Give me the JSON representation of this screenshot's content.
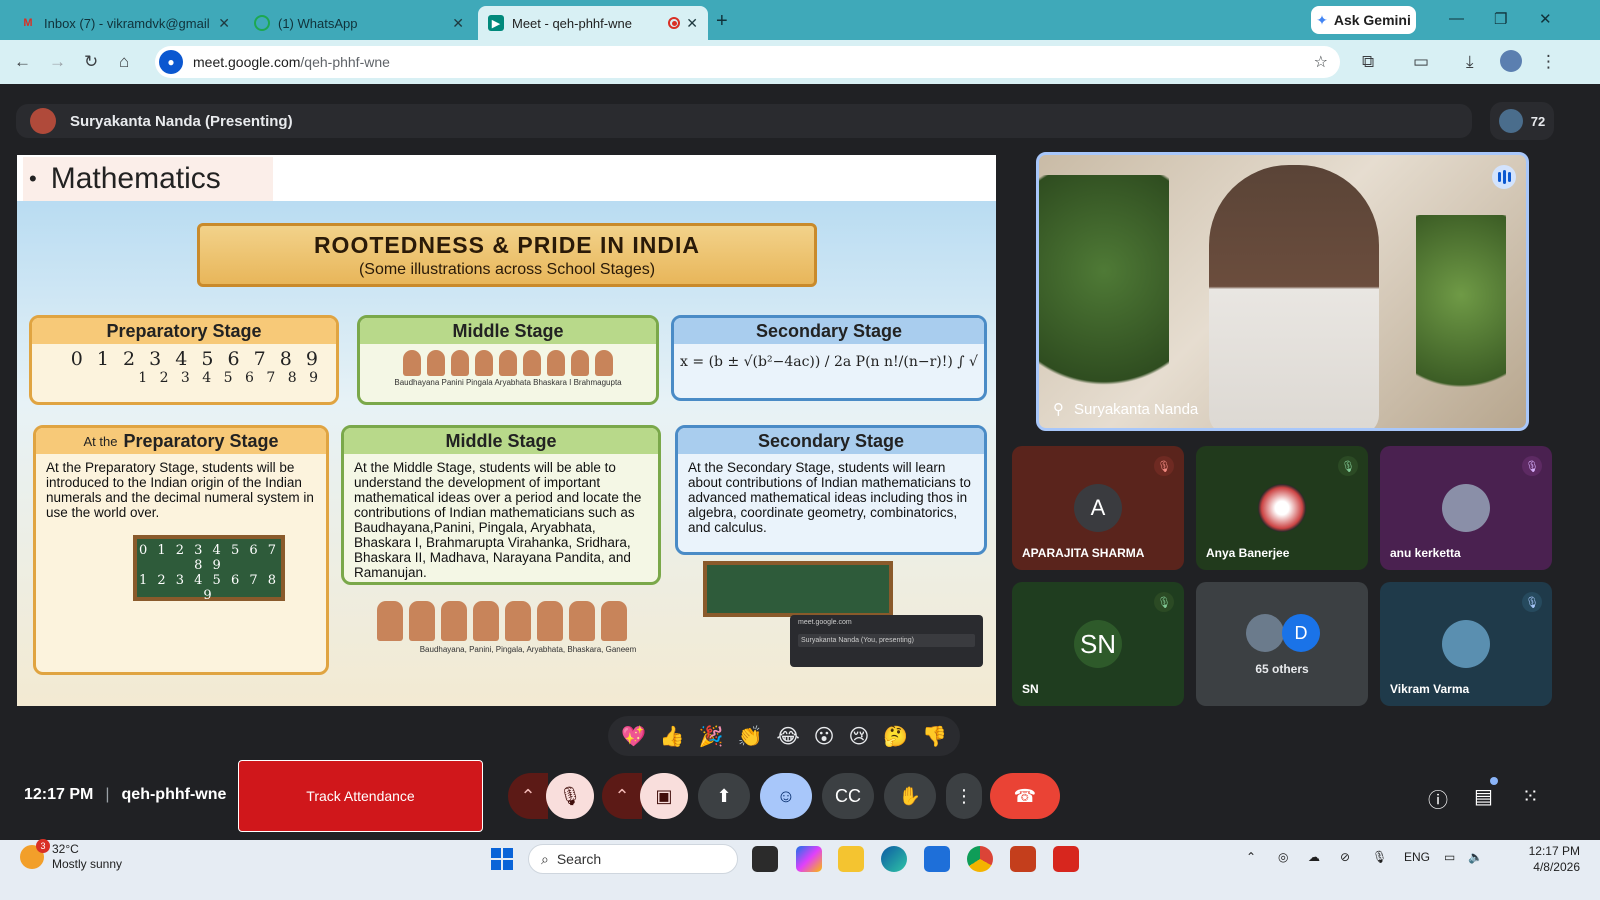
{
  "browser": {
    "tabs": [
      {
        "title": "Inbox (7) - vikramdvk@gmail.co",
        "icon": "gmail-icon"
      },
      {
        "title": "(1) WhatsApp",
        "icon": "whatsapp-icon"
      },
      {
        "title": "Meet - qeh-phhf-wne",
        "icon": "meet-icon",
        "active": true
      }
    ],
    "new_tab_glyph": "+",
    "ask_gemini": "Ask Gemini",
    "url_host": "meet.google.com",
    "url_path": "/qeh-phhf-wne"
  },
  "meet": {
    "presenting_label": "Suryakanta Nanda (Presenting)",
    "participant_count": "72",
    "slide": {
      "bullet": "Mathematics",
      "banner_title": "ROOTEDNESS & PRIDE IN INDIA",
      "banner_subtitle": "(Some illustrations across School Stages)",
      "top_stages": [
        {
          "title": "Preparatory Stage",
          "numerals_1": "0 1 2 3 4 5 6 7 8 9",
          "numerals_2": "1 2 3 4 5 6 7 8 9"
        },
        {
          "title": "Middle Stage",
          "caption": "Baudhayana  Panini  Pingala  Aryabhata  Bhaskara I  Brahmagupta"
        },
        {
          "title": "Secondary Stage",
          "formula": "x = (b ± √(b²−4ac)) / 2a   P(n n!/(n−r)!)  ∫ √"
        }
      ],
      "prep_prefix": "At the",
      "bottom_stages": [
        {
          "title": "Preparatory Stage",
          "text": "At the Preparatory Stage, students will be introduced to the Indian origin of the Indian numerals and the decimal numeral system in use the world over."
        },
        {
          "title": "Middle Stage",
          "text": "At the Middle Stage, students will be able to understand the development of important mathematical ideas over a period and locate the contributions of Indian mathematicians such as Baudhayana,Panini, Pingala, Aryabhata, Bhaskara I, Brahmarupta Virahanka, Sridhara, Bhaskara II, Madhava, Narayana Pandita, and Ramanujan."
        },
        {
          "title": "Secondary Stage",
          "text": "At the Secondary Stage, students will learn about contributions of Indian mathematicians to advanced mathematical ideas including thos in algebra, coordinate geometry, combinatorics, and calculus."
        }
      ],
      "board_row_1": "0 1 2 3 4 5 6 7 8 9",
      "board_row_2": "1 2 3 4 5 6 7 8 9",
      "bottom_caption": "Baudhayana, Panini, Pingala, Aryabhata, Bhaskara, Ganeem",
      "mini_pip_url": "meet.google.com",
      "mini_pip_name": "Suryakanta Nanda (You, presenting)"
    },
    "speaker_name": "Suryakanta Nanda",
    "tiles": [
      {
        "initial": "A",
        "name": "APARAJITA SHARMA",
        "bg": "#5a241c",
        "circle": "#3a3b3f"
      },
      {
        "initial": "",
        "name": "Anya Banerjee",
        "bg": "#213a1c",
        "circle": "#6a2a2a"
      },
      {
        "initial": "",
        "name": "anu kerketta",
        "bg": "#4a2150",
        "circle": "#8a8fa8"
      },
      {
        "initial": "SN",
        "name": "SN",
        "bg": "#1f3d1f",
        "circle": "#2e5a2a"
      },
      {
        "initial": "D",
        "name": "65 others",
        "bg": "#3c4043",
        "circle": "#1a73e8"
      },
      {
        "initial": "",
        "name": "Vikram Varma",
        "bg": "#1f3a4a",
        "circle": "#5a8fb0"
      }
    ],
    "reactions": [
      "💖",
      "👍",
      "🎉",
      "👏",
      "😂",
      "😮",
      "😢",
      "🤔",
      "👎"
    ],
    "time": "12:17 PM",
    "meeting_code": "qeh-phhf-wne",
    "track_attendance": "Track Attendance"
  },
  "taskbar": {
    "temperature": "32°C",
    "weather": "Mostly sunny",
    "weather_badge": "3",
    "search_placeholder": "Search",
    "language": "ENG",
    "time": "12:17 PM",
    "date": "4/8/2026"
  }
}
